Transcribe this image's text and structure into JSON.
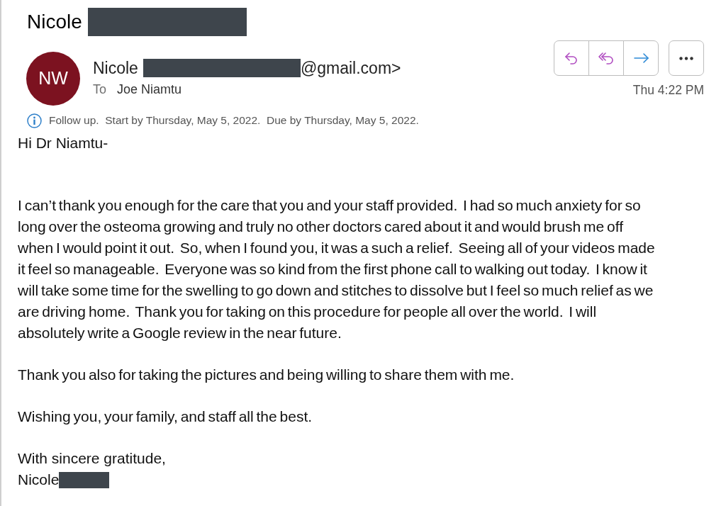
{
  "subject": {
    "text": "Nicole",
    "redacted": true
  },
  "sender": {
    "initials": "NW",
    "name": "Nicole",
    "redacted": true,
    "address_end": "@gmail.com>"
  },
  "recipients": {
    "label": "To",
    "names": "Joe Niamtu"
  },
  "time": "Thu 4:22 PM",
  "flag": {
    "text": "Follow up.  Start by Thursday, May 5, 2022.  Due by Thursday, May 5, 2022."
  },
  "body": {
    "greeting": "Hi Dr Niamtu-",
    "paragraphs": [
      "I can’t thank you enough for the care that you and your staff provided.  I had so much anxiety for so long over the osteoma growing and truly no other doctors cared about it and would brush me off when I would point it out.  So, when I found you, it was a such a relief.  Seeing all of your videos made it feel so manageable.  Everyone was so kind from the first phone call to walking out today.  I know it will take some time for the swelling to go down and stitches to dissolve but I feel so much relief as we are driving home.  Thank you for taking on this procedure for people all over the world.  I will absolutely write a Google review in the near future.",
      "Thank you also for taking the pictures and being willing to share them with me.",
      "Wishing you, your family, and staff all the best."
    ],
    "closing": "With sincere gratitude,",
    "signature": {
      "name": "Nicole",
      "redacted": true
    }
  }
}
